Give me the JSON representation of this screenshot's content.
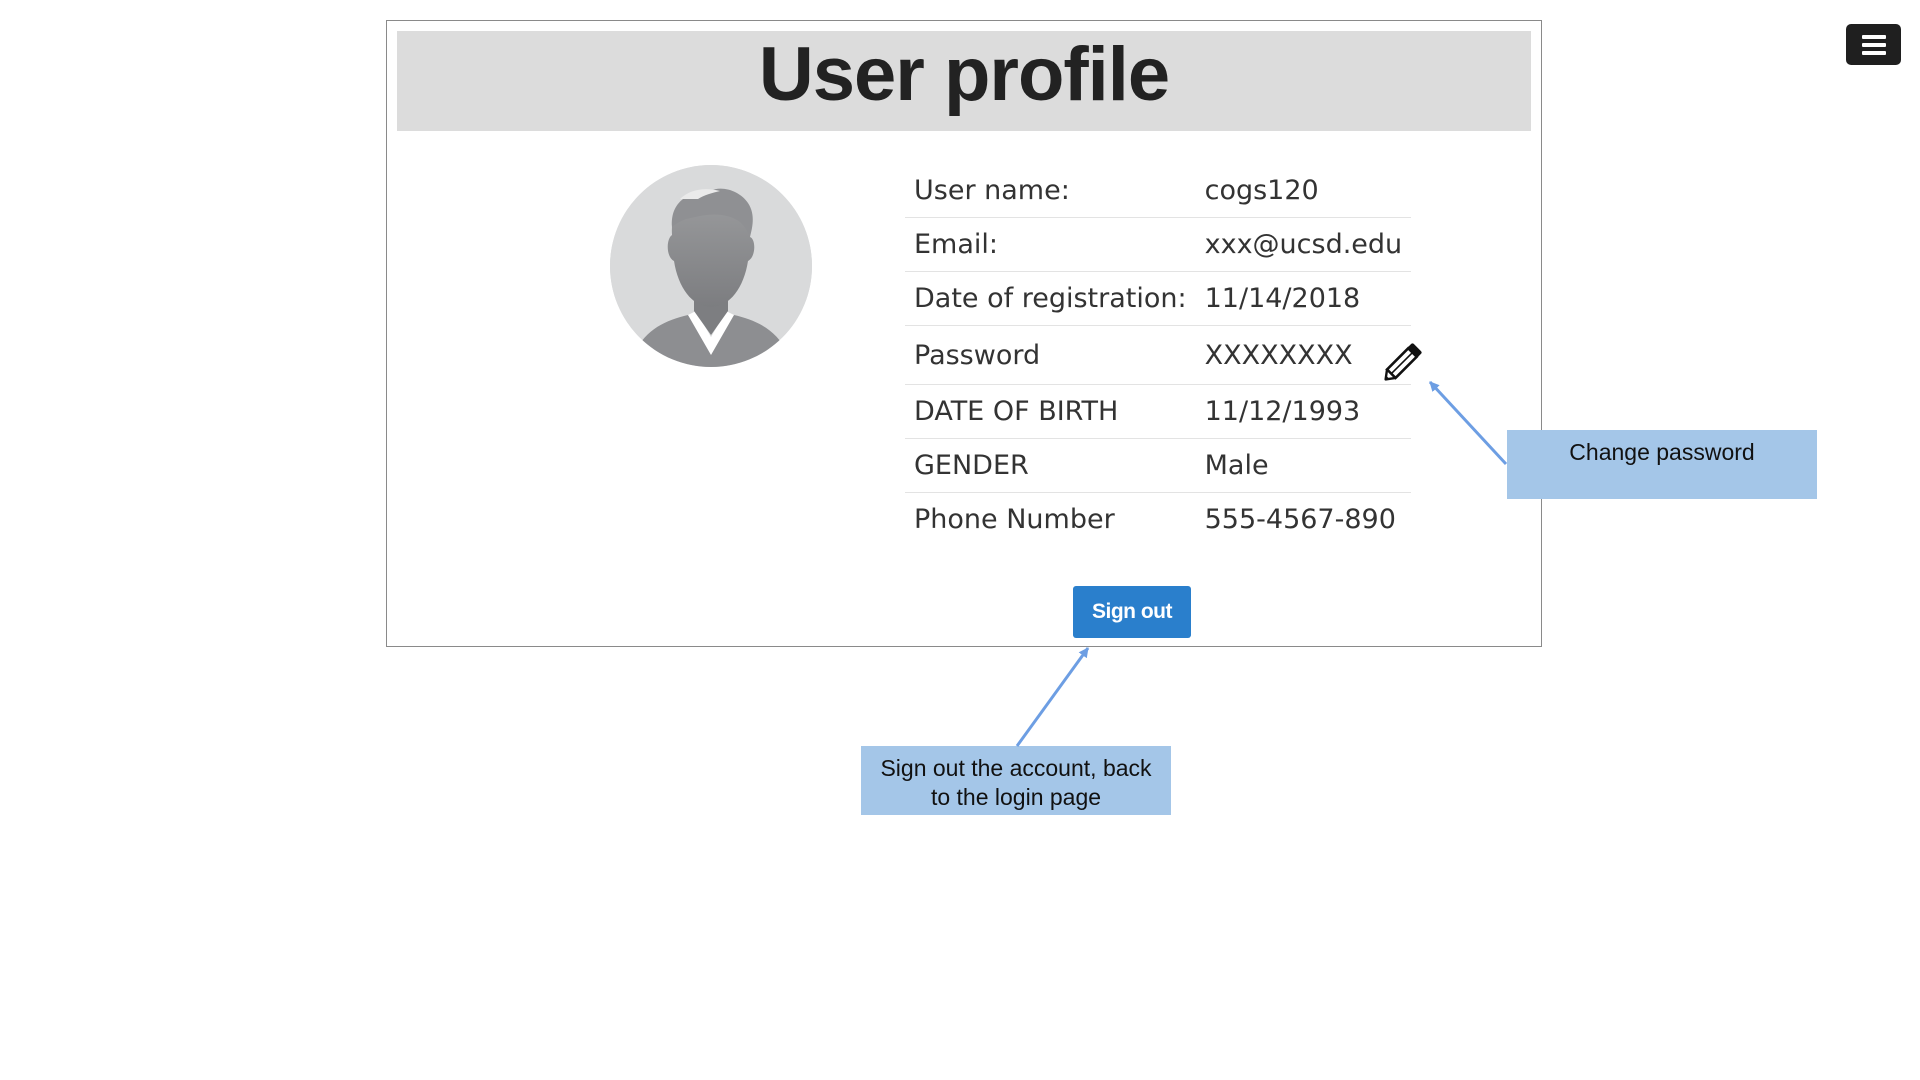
{
  "page": {
    "title": "User profile"
  },
  "profile": {
    "fields": [
      {
        "label": "User name:",
        "value": "cogs120"
      },
      {
        "label": "Email:",
        "value": "xxx@ucsd.edu"
      },
      {
        "label": "Date of registration:",
        "value": "11/14/2018"
      },
      {
        "label": "Password",
        "value": "XXXXXXXX"
      },
      {
        "label": "DATE OF BIRTH",
        "value": "11/12/1993"
      },
      {
        "label": "GENDER",
        "value": "Male"
      },
      {
        "label": "Phone Number",
        "value": "555-4567-890"
      }
    ],
    "avatar_icon": "default-user-avatar",
    "edit_password_icon": "pencil-icon"
  },
  "actions": {
    "sign_out_label": "Sign out"
  },
  "menu": {
    "icon": "hamburger-menu-icon"
  },
  "annotations": {
    "change_password": "Change password",
    "sign_out_line1": "Sign out the account, back",
    "sign_out_line2": "to the login page"
  },
  "colors": {
    "title_bar": "#dcdcdc",
    "sign_out_button": "#2a7fcc",
    "annotation_fill": "#a4c6e8",
    "annotation_arrow": "#6d9ee3",
    "menu_button": "#1f1f1f"
  }
}
